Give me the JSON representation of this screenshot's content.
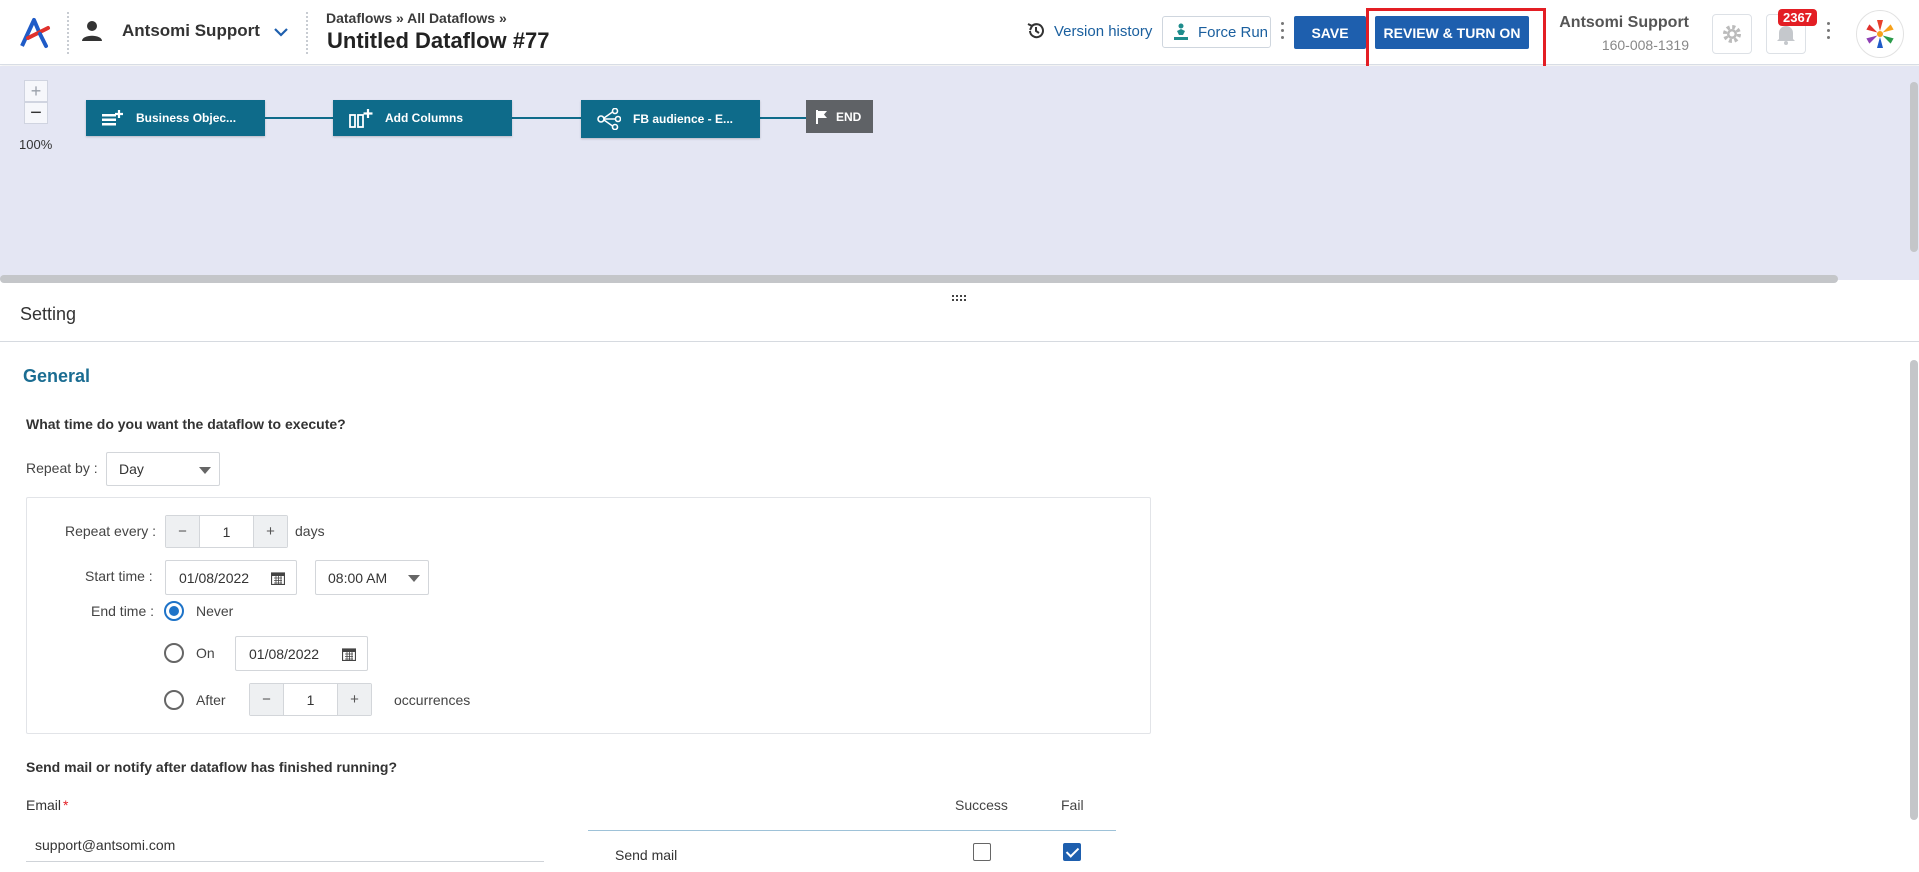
{
  "header": {
    "account_name": "Antsomi Support",
    "breadcrumb": "Dataflows » All Dataflows »",
    "title": "Untitled Dataflow #77",
    "version_history": "Version history",
    "force_run": "Force Run",
    "save": "SAVE",
    "review": "REVIEW & TURN ON",
    "user_name": "Antsomi Support",
    "user_id": "160-008-1319",
    "notification_count": "2367",
    "accent_color": "#1e5fae",
    "highlight_color": "#e31e24"
  },
  "canvas": {
    "zoom_in": "+",
    "zoom_out": "−",
    "zoom_level": "100%",
    "nodes": [
      {
        "label": "Business Objec...",
        "icon": "business-object-add-icon"
      },
      {
        "label": "Add Columns",
        "icon": "add-columns-icon"
      },
      {
        "label": "FB audience - E...",
        "icon": "share-nodes-icon"
      }
    ],
    "end_label": "END",
    "node_color": "#0e6b8a",
    "background": "#e4e6f3"
  },
  "setting": {
    "title": "Setting",
    "general": "General",
    "schedule_question": "What time do you want the dataflow to execute?",
    "repeat_by_label": "Repeat by :",
    "repeat_by_value": "Day",
    "repeat_every_label": "Repeat every :",
    "repeat_every_value": "1",
    "repeat_every_unit": "days",
    "start_time_label": "Start time :",
    "start_date": "01/08/2022",
    "start_hour": "08:00 AM",
    "end_time_label": "End time :",
    "end_never": "Never",
    "end_on": "On",
    "end_on_date": "01/08/2022",
    "end_after": "After",
    "end_after_value": "1",
    "end_after_unit": "occurrences",
    "minus": "−",
    "plus": "+",
    "notify_question": "Send mail or notify after dataflow has finished running?",
    "email_label": "Email",
    "email_required": "*",
    "email_value": "support@antsomi.com",
    "col_success": "Success",
    "col_fail": "Fail",
    "send_mail": "Send mail",
    "send_mail_success": false,
    "send_mail_fail": true
  }
}
